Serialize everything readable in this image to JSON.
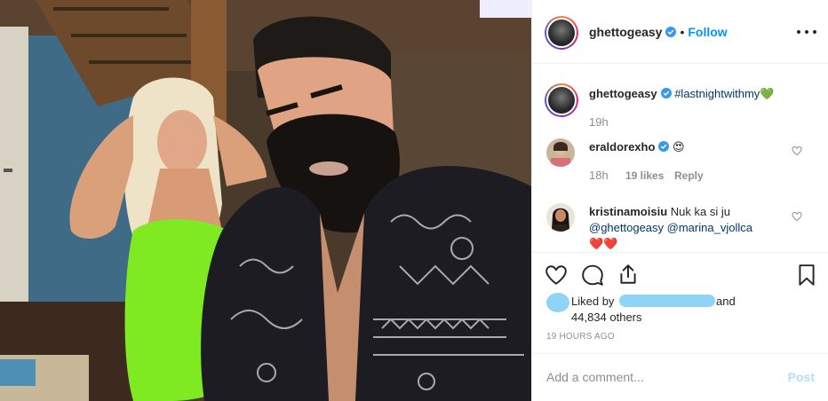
{
  "post": {
    "username": "ghettogeasy",
    "follow_label": "Follow",
    "separator": "•",
    "caption_hashtag": "#lastnightwithmy",
    "caption_emoji": "💚",
    "caption_time": "19h"
  },
  "comments": [
    {
      "username": "eraldorexho",
      "text": "😍",
      "time": "18h",
      "likes": "19 likes",
      "reply_label": "Reply"
    },
    {
      "username": "kristinamoisiu",
      "text": "Nuk ka si ju",
      "mention1": "@ghettogeasy",
      "mention2": "@marina_vjollca",
      "emoji": "❤️❤️"
    }
  ],
  "likes": {
    "prefix": "Liked by",
    "conj": "and",
    "others": "44,834 others"
  },
  "timestamp": "19 HOURS AGO",
  "add_comment": {
    "placeholder": "Add a comment...",
    "post_label": "Post"
  },
  "colors": {
    "accent": "#0095f6",
    "link": "#00376b",
    "muted": "#8e8e8e",
    "redacted": "#8fd4f7"
  },
  "icons": [
    "verified-badge-icon",
    "more-options-icon",
    "heart-icon",
    "comment-icon",
    "share-icon",
    "bookmark-icon"
  ]
}
